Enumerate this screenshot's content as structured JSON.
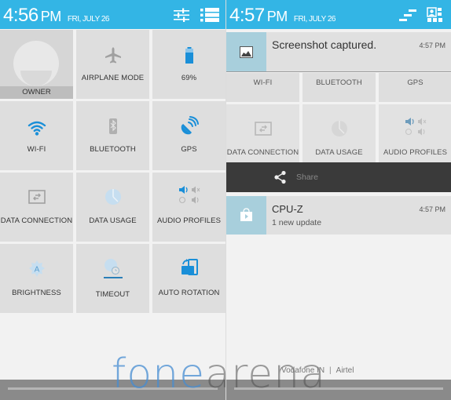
{
  "left": {
    "status_bar": {
      "time": "4:56",
      "ampm": "PM",
      "date": "FRI, JULY 26",
      "icons": [
        "settings-sliders-icon",
        "notification-list-icon"
      ]
    },
    "tiles": [
      {
        "id": "owner",
        "label": "OWNER",
        "icon": "user-avatar-icon"
      },
      {
        "id": "airplane",
        "label": "AIRPLANE MODE",
        "icon": "airplane-icon"
      },
      {
        "id": "battery",
        "label": "69%",
        "icon": "battery-icon"
      },
      {
        "id": "wifi",
        "label": "WI-FI",
        "icon": "wifi-icon"
      },
      {
        "id": "bluetooth",
        "label": "BLUETOOTH",
        "icon": "bluetooth-icon"
      },
      {
        "id": "gps",
        "label": "GPS",
        "icon": "gps-satellite-icon"
      },
      {
        "id": "data_connection",
        "label": "DATA CONNECTION",
        "icon": "data-connection-icon"
      },
      {
        "id": "data_usage",
        "label": "DATA USAGE",
        "icon": "data-usage-pie-icon"
      },
      {
        "id": "audio_profiles",
        "label": "AUDIO PROFILES",
        "icon": "audio-profiles-icon"
      },
      {
        "id": "brightness",
        "label": "BRIGHTNESS",
        "icon": "brightness-auto-icon"
      },
      {
        "id": "timeout",
        "label": "TIMEOUT",
        "icon": "timeout-icon"
      },
      {
        "id": "auto_rotation",
        "label": "AUTO ROTATION",
        "icon": "auto-rotation-icon"
      }
    ]
  },
  "right": {
    "status_bar": {
      "time": "4:57",
      "ampm": "PM",
      "date": "FRI, JULY 26",
      "icons": [
        "clear-all-icon",
        "quick-settings-icon"
      ]
    },
    "notifications": [
      {
        "title": "Screenshot captured.",
        "time": "4:57 PM",
        "icon": "image-icon"
      },
      {
        "title": "CPU-Z",
        "subtitle": "1 new update",
        "time": "4:57 PM",
        "icon": "play-store-icon"
      }
    ],
    "partial_tiles": [
      {
        "label": "WI-FI"
      },
      {
        "label": "BLUETOOTH"
      },
      {
        "label": "GPS"
      },
      {
        "label": "DATA CONNECTION",
        "icon": "data-connection-icon"
      },
      {
        "label": "DATA USAGE",
        "icon": "data-usage-pie-icon"
      },
      {
        "label": "AUDIO PROFILES",
        "icon": "audio-profiles-icon"
      }
    ],
    "share_action": {
      "label": "Share",
      "icon": "share-icon"
    }
  },
  "carrier": {
    "primary": "Vodafone IN",
    "separator": "|",
    "secondary": "Airtel"
  },
  "watermark": {
    "part1": "fone",
    "part2": "arena"
  },
  "colors": {
    "accent": "#33b5e5",
    "tile": "#dedede",
    "active_icon": "#1a8fd8",
    "inactive_icon": "#a0a0a0"
  }
}
